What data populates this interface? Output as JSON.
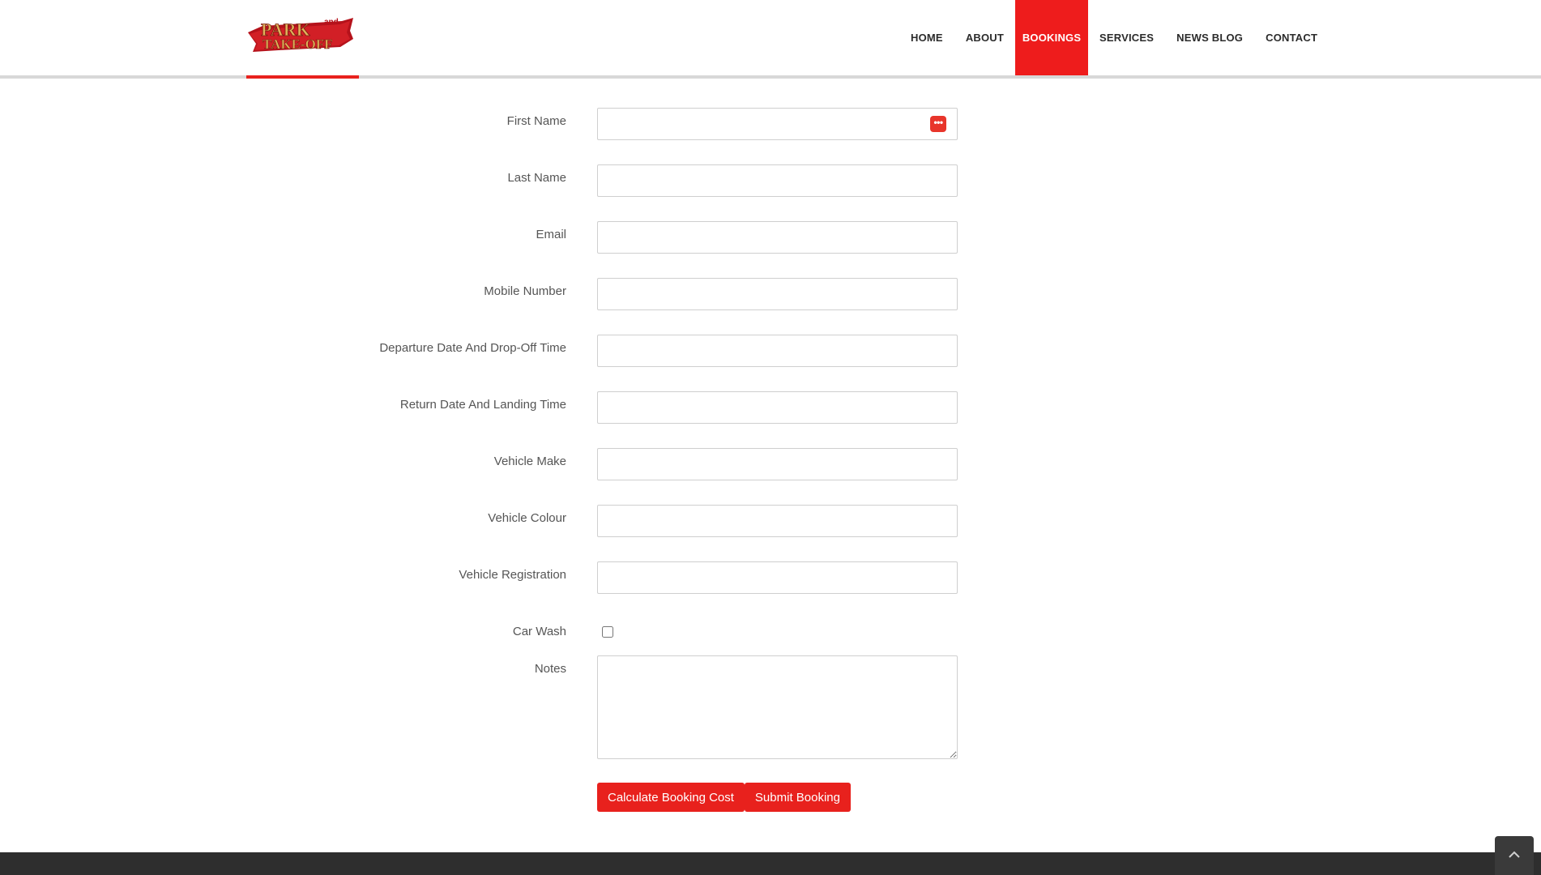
{
  "brand": {
    "logo_text_main": "PARK",
    "logo_text_and": "and",
    "logo_text_sub": "TAKE-OFF",
    "colors": {
      "accent": "#e8211d",
      "logo_gold": "#e0b25a",
      "logo_red": "#b5121b"
    }
  },
  "nav": {
    "items": [
      {
        "label": "HOME"
      },
      {
        "label": "ABOUT"
      },
      {
        "label": "BOOKINGS",
        "active": true
      },
      {
        "label": "SERVICES"
      },
      {
        "label": "NEWS BLOG"
      },
      {
        "label": "CONTACT"
      }
    ]
  },
  "form": {
    "first_name": {
      "label": "First Name",
      "value": ""
    },
    "last_name": {
      "label": "Last Name",
      "value": ""
    },
    "email": {
      "label": "Email",
      "value": ""
    },
    "mobile": {
      "label": "Mobile Number",
      "value": ""
    },
    "departure": {
      "label": "Departure Date And Drop-Off Time",
      "value": ""
    },
    "return": {
      "label": "Return Date And Landing Time",
      "value": ""
    },
    "vehicle_make": {
      "label": "Vehicle Make",
      "value": ""
    },
    "vehicle_colour": {
      "label": "Vehicle Colour",
      "value": ""
    },
    "vehicle_registration": {
      "label": "Vehicle Registration",
      "value": ""
    },
    "car_wash": {
      "label": "Car Wash",
      "checked": false
    },
    "notes": {
      "label": "Notes",
      "value": ""
    },
    "autofill_icon": "password-manager-icon"
  },
  "buttons": {
    "calculate": "Calculate Booking Cost",
    "submit": "Submit Booking"
  },
  "footer": {
    "to_top_icon": "chevron-up-icon"
  }
}
